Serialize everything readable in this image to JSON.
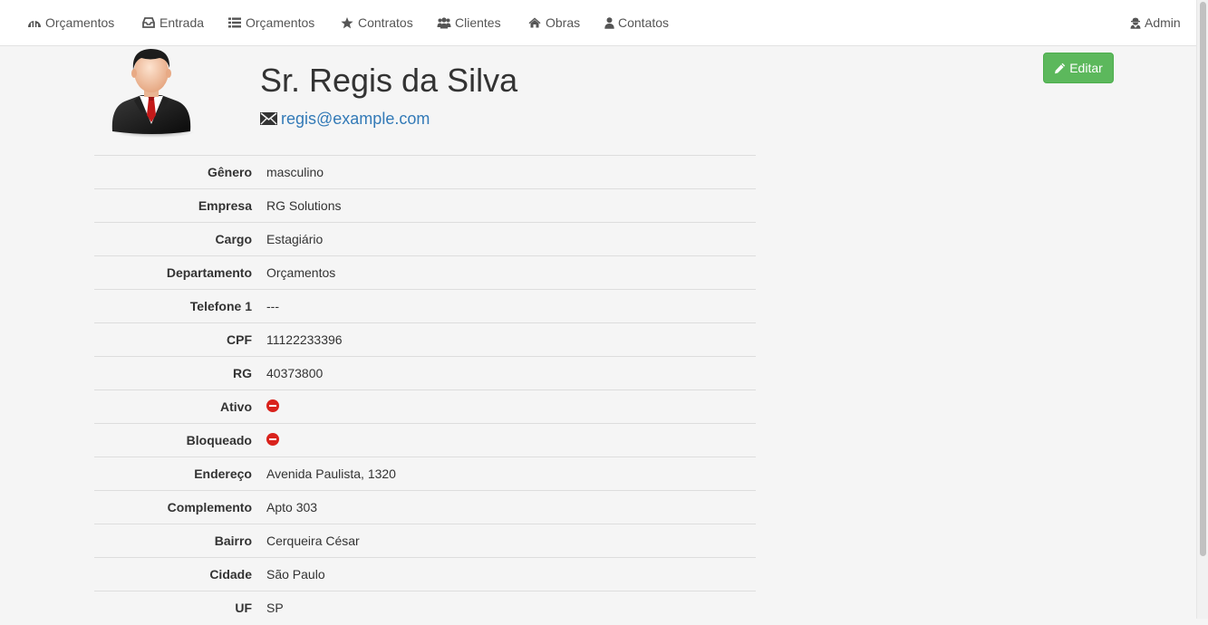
{
  "nav": {
    "brand": "Orçamentos",
    "items": [
      {
        "label": "Entrada",
        "icon": "inbox-icon"
      },
      {
        "label": "Orçamentos",
        "icon": "list-icon"
      },
      {
        "label": "Contratos",
        "icon": "star-icon"
      },
      {
        "label": "Clientes",
        "icon": "users-icon"
      },
      {
        "label": "Obras",
        "icon": "home-icon"
      },
      {
        "label": "Contatos",
        "icon": "user-icon"
      }
    ],
    "user": "Admin"
  },
  "contact": {
    "name": "Sr. Regis da Silva",
    "email": "regis@example.com",
    "edit_label": "Editar"
  },
  "details": [
    {
      "label": "Gênero",
      "value": "masculino"
    },
    {
      "label": "Empresa",
      "value": "RG Solutions"
    },
    {
      "label": "Cargo",
      "value": "Estagiário"
    },
    {
      "label": "Departamento",
      "value": "Orçamentos"
    },
    {
      "label": "Telefone 1",
      "value": "---"
    },
    {
      "label": "CPF",
      "value": "11122233396"
    },
    {
      "label": "RG",
      "value": "40373800"
    },
    {
      "label": "Ativo",
      "value": null,
      "icon": "minus-circle-icon",
      "status": false
    },
    {
      "label": "Bloqueado",
      "value": null,
      "icon": "minus-circle-icon",
      "status": false
    },
    {
      "label": "Endereço",
      "value": "Avenida Paulista, 1320"
    },
    {
      "label": "Complemento",
      "value": "Apto 303"
    },
    {
      "label": "Bairro",
      "value": "Cerqueira César"
    },
    {
      "label": "Cidade",
      "value": "São Paulo"
    },
    {
      "label": "UF",
      "value": "SP"
    }
  ],
  "colors": {
    "link": "#337ab7",
    "success": "#5cb85c",
    "danger": "#d9221c",
    "background": "#f5f5f5"
  }
}
